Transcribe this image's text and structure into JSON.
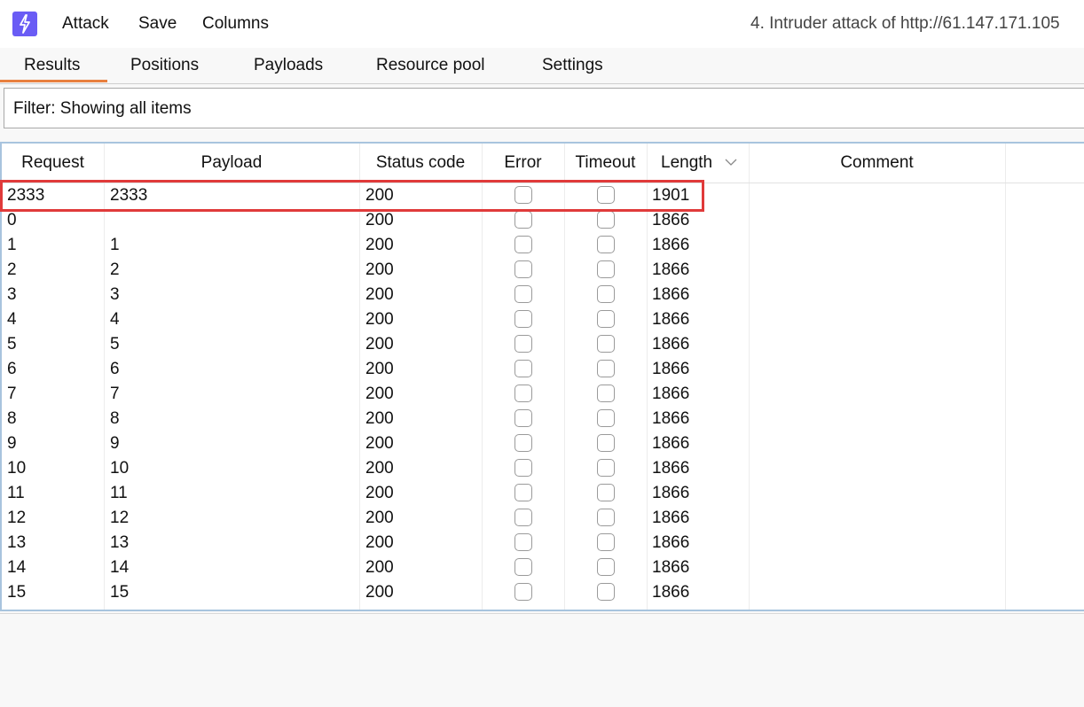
{
  "app": {
    "icon": "lightning-bolt-icon",
    "menu": [
      "Attack",
      "Save",
      "Columns"
    ],
    "title": "4. Intruder attack of http://61.147.171.105"
  },
  "tabs": [
    {
      "label": "Results",
      "active": true
    },
    {
      "label": "Positions"
    },
    {
      "label": "Payloads"
    },
    {
      "label": "Resource pool"
    },
    {
      "label": "Settings"
    }
  ],
  "filter": {
    "label": "Filter: Showing all items"
  },
  "table": {
    "columns": [
      "Request",
      "Payload",
      "Status code",
      "Error",
      "Timeout",
      "Length",
      "Comment"
    ],
    "sort_column": "Length",
    "rows": [
      {
        "request": "2333",
        "payload": "2333",
        "status": "200",
        "length": "1901",
        "highlighted": true
      },
      {
        "request": "0",
        "payload": "",
        "status": "200",
        "length": "1866"
      },
      {
        "request": "1",
        "payload": "1",
        "status": "200",
        "length": "1866"
      },
      {
        "request": "2",
        "payload": "2",
        "status": "200",
        "length": "1866"
      },
      {
        "request": "3",
        "payload": "3",
        "status": "200",
        "length": "1866"
      },
      {
        "request": "4",
        "payload": "4",
        "status": "200",
        "length": "1866"
      },
      {
        "request": "5",
        "payload": "5",
        "status": "200",
        "length": "1866"
      },
      {
        "request": "6",
        "payload": "6",
        "status": "200",
        "length": "1866"
      },
      {
        "request": "7",
        "payload": "7",
        "status": "200",
        "length": "1866"
      },
      {
        "request": "8",
        "payload": "8",
        "status": "200",
        "length": "1866"
      },
      {
        "request": "9",
        "payload": "9",
        "status": "200",
        "length": "1866"
      },
      {
        "request": "10",
        "payload": "10",
        "status": "200",
        "length": "1866"
      },
      {
        "request": "11",
        "payload": "11",
        "status": "200",
        "length": "1866"
      },
      {
        "request": "12",
        "payload": "12",
        "status": "200",
        "length": "1866"
      },
      {
        "request": "13",
        "payload": "13",
        "status": "200",
        "length": "1866"
      },
      {
        "request": "14",
        "payload": "14",
        "status": "200",
        "length": "1866"
      },
      {
        "request": "15",
        "payload": "15",
        "status": "200",
        "length": "1866"
      }
    ]
  },
  "colors": {
    "accent_tab": "#e8803f",
    "app_icon": "#6a5cf5",
    "highlight_border": "#e03a3a",
    "table_border": "#a8c4de"
  }
}
